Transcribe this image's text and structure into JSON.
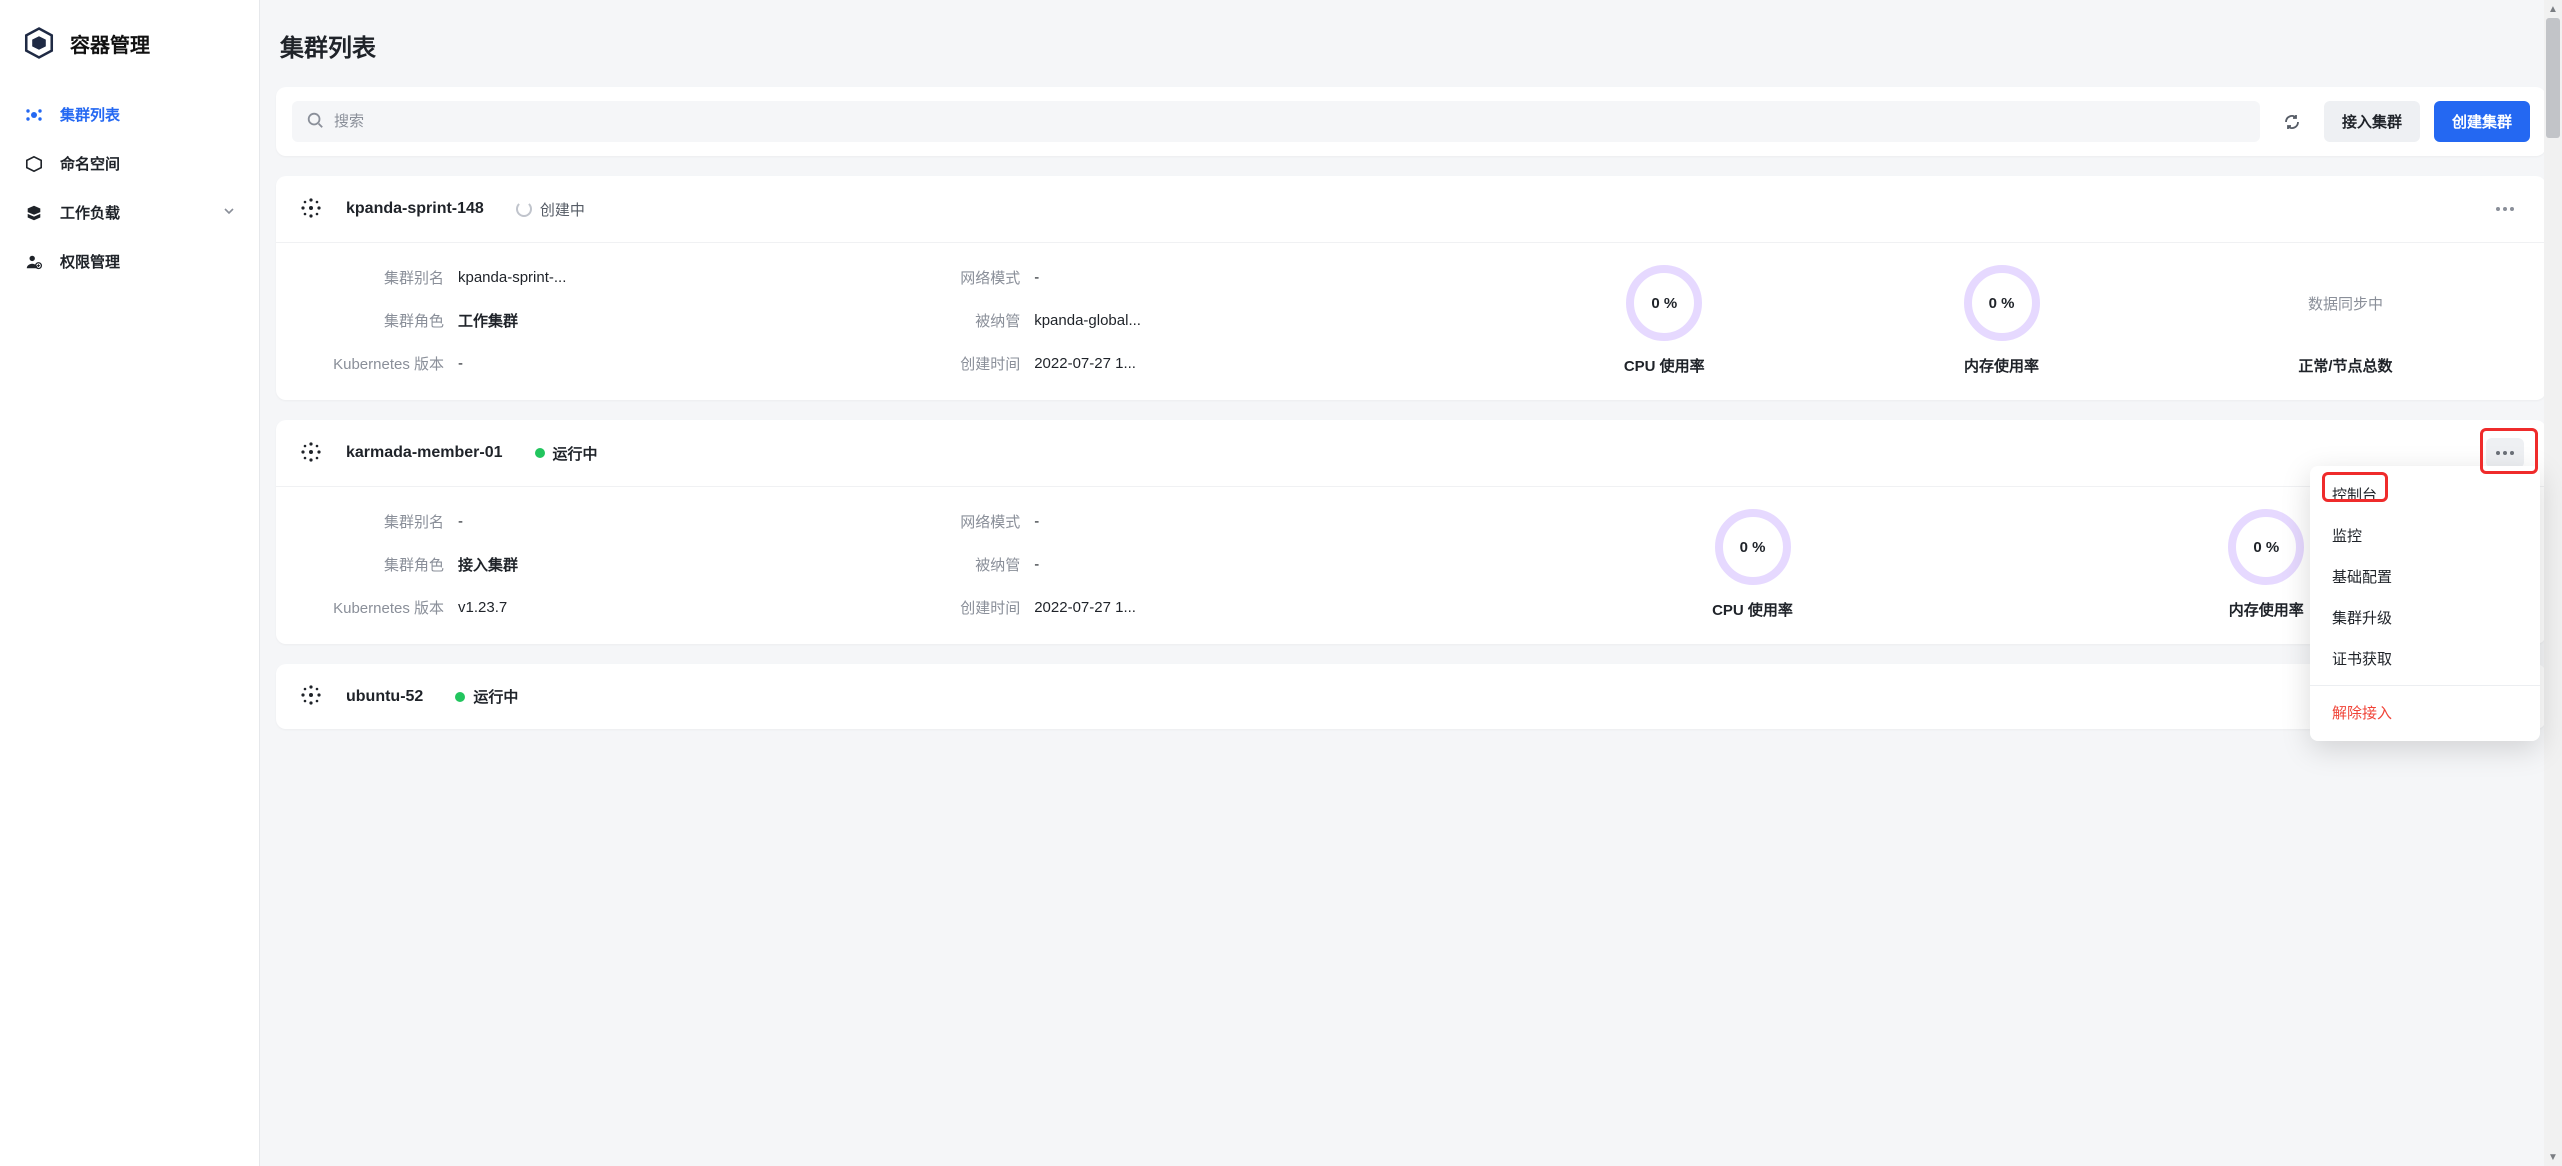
{
  "brand": {
    "title": "容器管理"
  },
  "nav": {
    "items": [
      {
        "label": "集群列表",
        "active": true,
        "icon": "cluster-list"
      },
      {
        "label": "命名空间",
        "active": false,
        "icon": "namespace"
      },
      {
        "label": "工作负载",
        "active": false,
        "icon": "workload",
        "has_children": true
      },
      {
        "label": "权限管理",
        "active": false,
        "icon": "permission"
      }
    ]
  },
  "page": {
    "title": "集群列表"
  },
  "toolbar": {
    "search_placeholder": "搜索",
    "connect_label": "接入集群",
    "create_label": "创建集群"
  },
  "labels": {
    "alias": "集群别名",
    "role": "集群角色",
    "k8s": "Kubernetes 版本",
    "network": "网络模式",
    "managed_by": "被纳管",
    "created": "创建时间",
    "cpu": "CPU 使用率",
    "mem": "内存使用率",
    "nodes": "正常/节点总数",
    "syncing": "数据同步中"
  },
  "clusters": [
    {
      "name": "kpanda-sprint-148",
      "status_type": "creating",
      "status_text": "创建中",
      "alias": "kpanda-sprint-...",
      "role": "工作集群",
      "k8s": "-",
      "network": "-",
      "managed_by": "kpanda-global...",
      "created": "2022-07-27 1...",
      "cpu": "0 %",
      "mem": "0 %",
      "nodes_display": "syncing"
    },
    {
      "name": "karmada-member-01",
      "status_type": "running",
      "status_text": "运行中",
      "alias": "-",
      "role": "接入集群",
      "k8s": "v1.23.7",
      "network": "-",
      "managed_by": "-",
      "created": "2022-07-27 1...",
      "cpu": "0 %",
      "mem": "0 %",
      "nodes_display": "syncing",
      "menu_open": true
    },
    {
      "name": "ubuntu-52",
      "status_type": "running",
      "status_text": "运行中"
    }
  ],
  "dropdown": {
    "items": [
      {
        "label": "控制台",
        "highlight": true
      },
      {
        "label": "监控"
      },
      {
        "label": "基础配置"
      },
      {
        "label": "集群升级"
      },
      {
        "label": "证书获取"
      }
    ],
    "danger": {
      "label": "解除接入"
    }
  }
}
